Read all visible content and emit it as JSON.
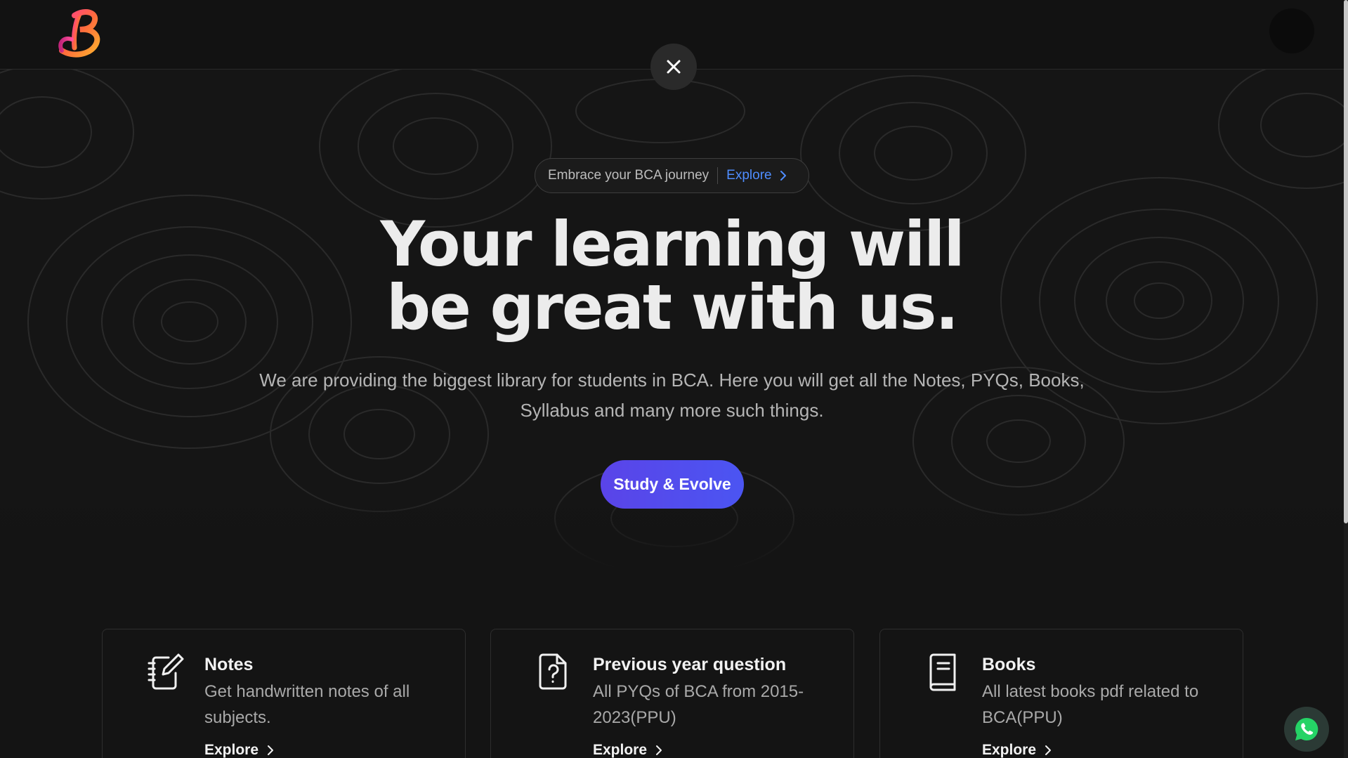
{
  "header": {
    "logo_letter": "B",
    "close_label": "Close"
  },
  "hero": {
    "pill_text": "Embrace your BCA journey",
    "pill_link": "Explore",
    "headline_line1": "Your learning will",
    "headline_line2": "be great with us.",
    "subtitle": "We are providing the biggest library for students in BCA. Here you will get all the Notes, PYQs, Books, Syllabus and many more such things.",
    "cta_label": "Study & Evolve"
  },
  "cards": [
    {
      "icon": "notebook-pen-icon",
      "title": "Notes",
      "description": "Get handwritten notes of all subjects.",
      "link": "Explore"
    },
    {
      "icon": "file-question-icon",
      "title": "Previous year question",
      "description": "All PYQs of BCA from 2015-2023(PPU)",
      "link": "Explore"
    },
    {
      "icon": "book-icon",
      "title": "Books",
      "description": "All latest books pdf related to BCA(PPU)",
      "link": "Explore"
    }
  ],
  "colors": {
    "background": "#141414",
    "accent_link": "#4f8dff",
    "cta_gradient_start": "#5a44e8",
    "cta_gradient_end": "#4b55f2",
    "whatsapp_green": "#25d366"
  }
}
